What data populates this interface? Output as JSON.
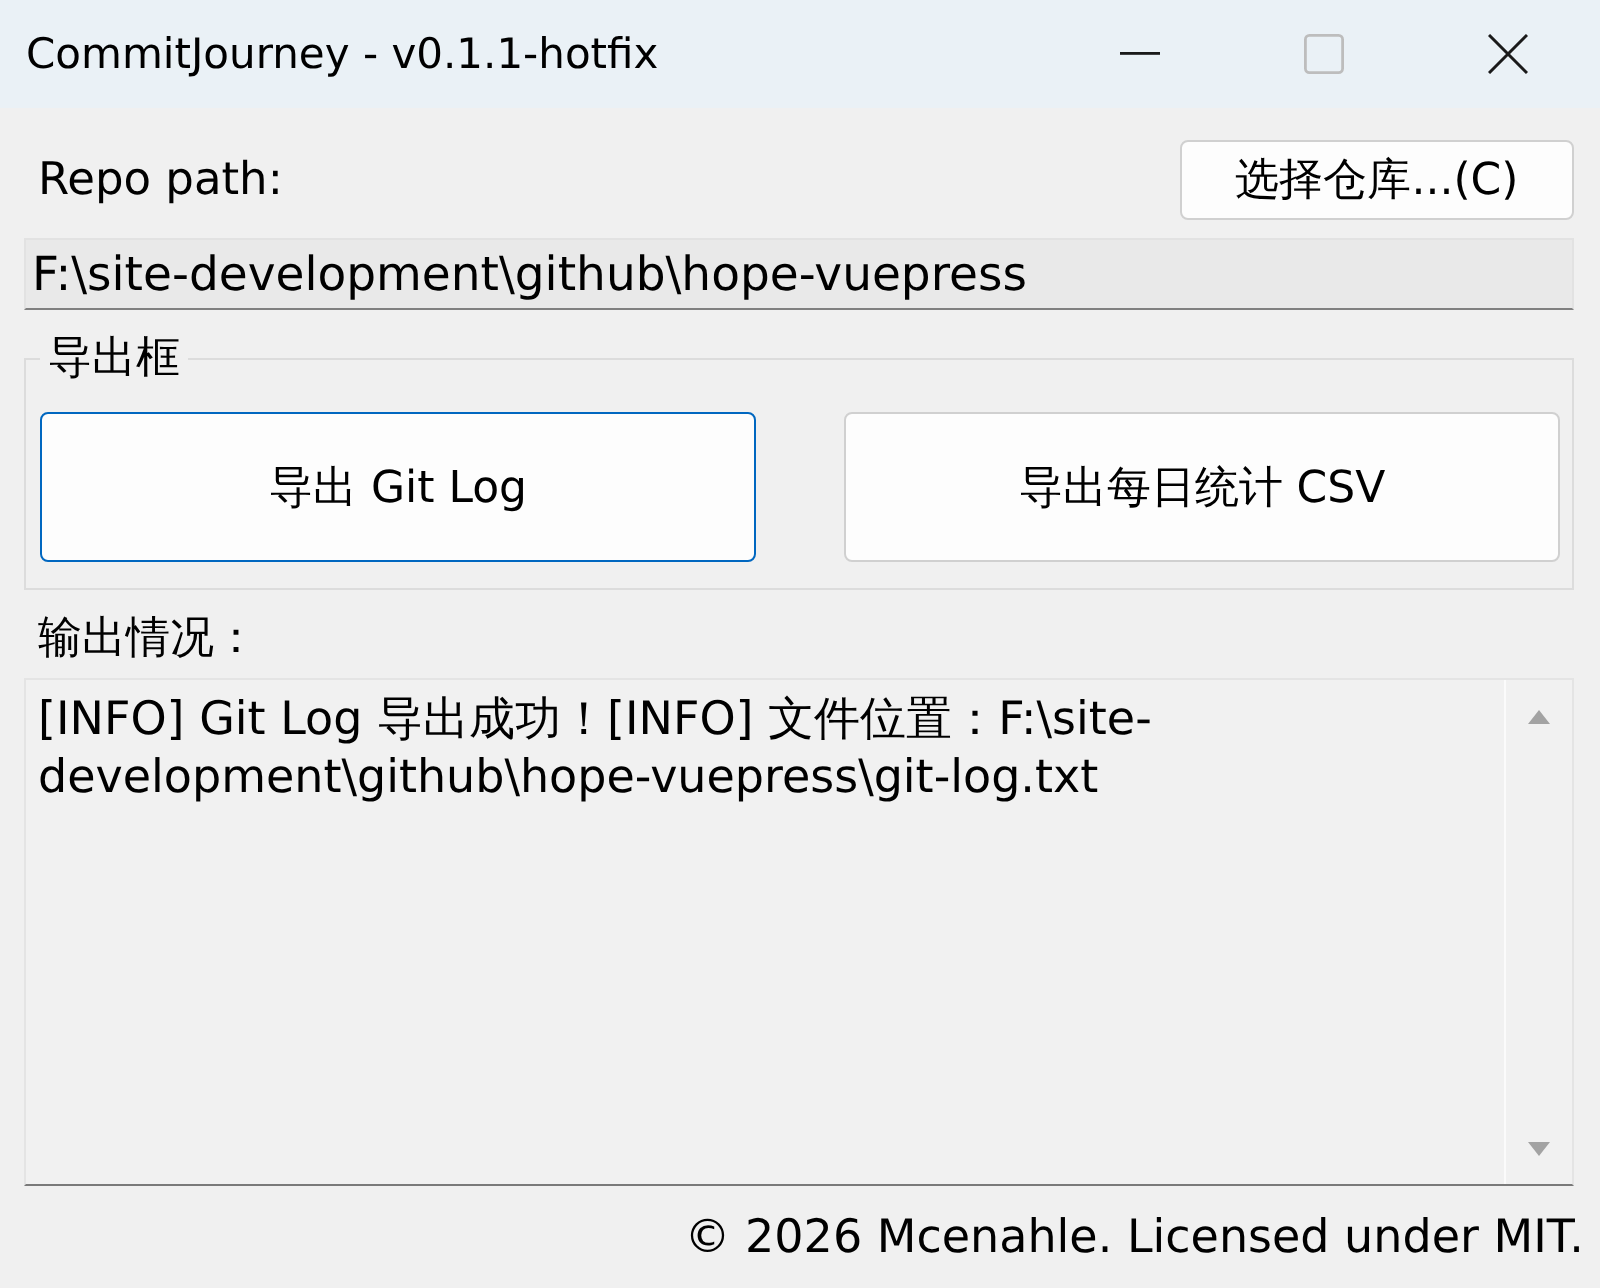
{
  "window": {
    "title": "CommitJourney - v0.1.1-hotfix",
    "controls": [
      {
        "kind": "minimize",
        "disabled": false
      },
      {
        "kind": "maximize",
        "disabled": true
      },
      {
        "kind": "close",
        "disabled": false
      }
    ]
  },
  "repo": {
    "label": "Repo path:",
    "browse_button": "选择仓库...(C)",
    "path": "F:\\site-development\\github\\hope-vuepress"
  },
  "export_group": {
    "title": "导出框",
    "buttons": [
      {
        "label": "导出 Git Log",
        "focused": true
      },
      {
        "label": "导出每日统计 CSV",
        "focused": false
      }
    ]
  },
  "output": {
    "label": "输出情况：",
    "text": "[INFO] Git Log 导出成功！[INFO] 文件位置：F:\\site-development\\github\\hope-vuepress\\git-log.txt"
  },
  "status_bar": {
    "text": "© 2026 Mcenahle. Licensed under MIT."
  }
}
